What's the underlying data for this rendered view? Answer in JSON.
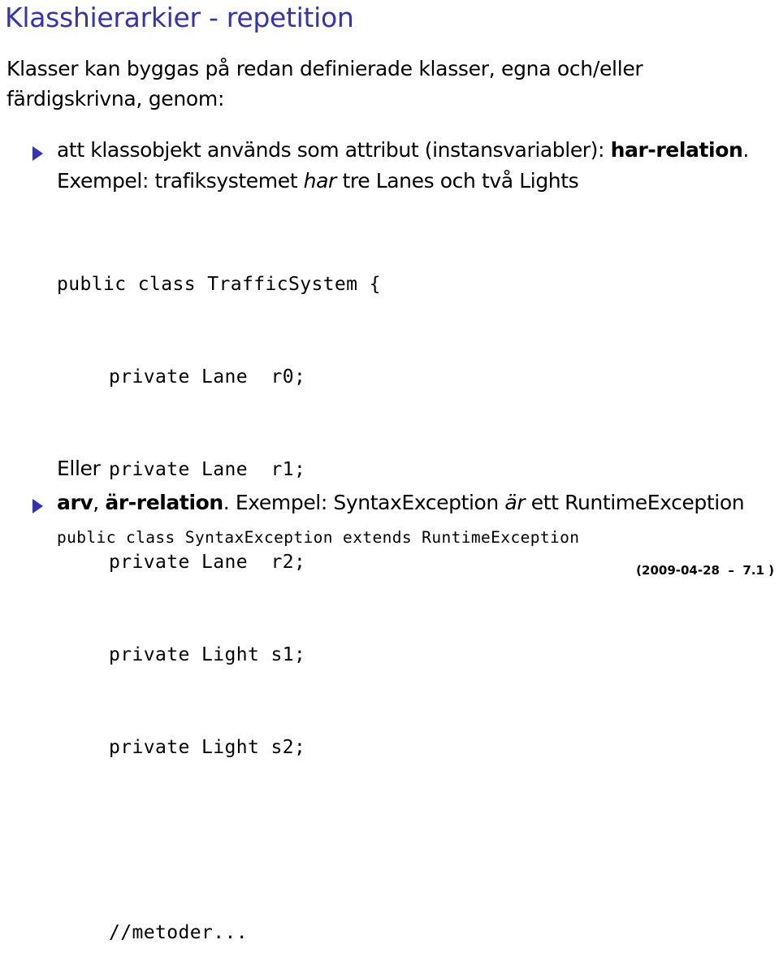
{
  "slide": {
    "title": "Klasshierarkier - repetition",
    "intro_line1": "Klasser kan byggas på redan definierade klasser, egna och/eller",
    "intro_line2": "färdigskrivna, genom:",
    "bullet1": {
      "text": "att klassobjekt används som attribut (instansvariabler): ",
      "bold": "har-relation",
      "end": ".",
      "example_prefix": "Exempel: trafiksystemet ",
      "example_italic": "har",
      "example_suffix": " tre Lanes och två Lights"
    },
    "code_block": [
      "public class TrafficSystem {",
      "    private Lane  r0;",
      "    private Lane  r1;",
      "    private Lane  r2;",
      "    private Light s1;",
      "    private Light s2;",
      "",
      "    //metoder..."
    ],
    "eller": "Eller",
    "bullet2": {
      "bold1": "arv",
      "comma": ", ",
      "bold2": "är-relation",
      "text": ". Exempel: SyntaxException ",
      "italic": "är",
      "suffix": " ett RuntimeException"
    },
    "code_line2": "public class SyntaxException extends RuntimeException",
    "footer": "(2009-04-28  –  7.1 )",
    "accent_color": "#3333b3"
  }
}
